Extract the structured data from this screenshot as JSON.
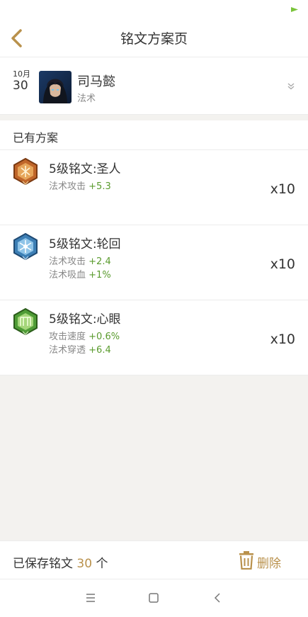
{
  "header": {
    "title": "铭文方案页"
  },
  "hero": {
    "month": "10月",
    "day": "30",
    "name": "司马懿",
    "role": "法术"
  },
  "section": {
    "title": "已有方案"
  },
  "runes": [
    {
      "name": "5级铭文:圣人",
      "icon": "rune-saint-icon",
      "color": "#c0662a",
      "count": "x10",
      "attrs": [
        {
          "label": "法术攻击",
          "value": "+5.3"
        }
      ]
    },
    {
      "name": "5级铭文:轮回",
      "icon": "rune-cycle-icon",
      "color": "#3d7fb5",
      "count": "x10",
      "attrs": [
        {
          "label": "法术攻击",
          "value": "+2.4"
        },
        {
          "label": "法术吸血",
          "value": "+1%"
        }
      ]
    },
    {
      "name": "5级铭文:心眼",
      "icon": "rune-eye-icon",
      "color": "#4f9c36",
      "count": "x10",
      "attrs": [
        {
          "label": "攻击速度",
          "value": "+0.6%"
        },
        {
          "label": "法术穿透",
          "value": "+6.4"
        }
      ]
    }
  ],
  "footer": {
    "saved_prefix": "已保存铭文",
    "saved_count": "30",
    "saved_unit": "个",
    "delete_label": "删除"
  },
  "colors": {
    "accent": "#b9914c",
    "positive": "#5a9b2e"
  }
}
